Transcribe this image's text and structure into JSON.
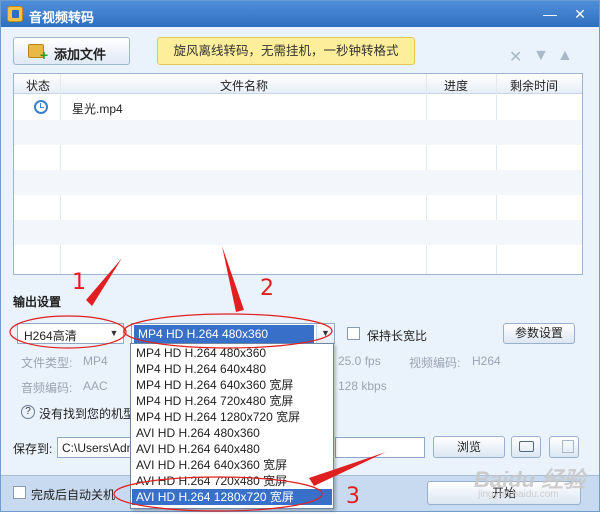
{
  "window": {
    "title": "音视频转码"
  },
  "toolbar": {
    "add_file_label": "添加文件",
    "promo_text": "旋风离线转码，无需挂机，一秒钟转格式"
  },
  "file_table": {
    "columns": [
      "状态",
      "文件名称",
      "进度",
      "剩余时间"
    ],
    "rows": [
      {
        "status_icon": "clock-icon",
        "name": "星光.mp4",
        "progress": "",
        "remaining": ""
      }
    ]
  },
  "output": {
    "section_title": "输出设置",
    "preset": "H264高清",
    "format": "MP4 HD H.264 480x360",
    "keep_ratio_label": "保持长宽比",
    "settings_button": "参数设置",
    "file_type_label": "文件类型:",
    "file_type_value": "MP4",
    "audio_codec_label": "音频编码:",
    "audio_codec_value": "AAC",
    "fps_value": "25.0 fps",
    "video_codec_label": "视频编码:",
    "video_codec_value": "H264",
    "bitrate_value": "128 kbps",
    "help_text": "没有找到您的机型"
  },
  "save": {
    "label": "保存到:",
    "path": "C:\\Users\\Adm",
    "browse_button": "浏览"
  },
  "dropdown": {
    "options": [
      "MP4 HD H.264 480x360",
      "MP4 HD H.264 640x480",
      "MP4 HD H.264 640x360 宽屏",
      "MP4 HD H.264 720x480 宽屏",
      "MP4 HD H.264 1280x720 宽屏",
      "AVI HD H.264 480x360",
      "AVI HD H.264 640x480",
      "AVI HD H.264 640x360 宽屏",
      "AVI HD H.264 720x480 宽屏",
      "AVI HD H.264 1280x720 宽屏"
    ],
    "selected_index": 9
  },
  "footer": {
    "auto_shutdown_label": "完成后自动关机",
    "start_button": "开始"
  },
  "annotations": {
    "marks": [
      "1",
      "2",
      "3"
    ],
    "color": "#e02020"
  },
  "watermark": {
    "brand": "Baidu 经验",
    "sub": "jingyan.baidu.com"
  }
}
